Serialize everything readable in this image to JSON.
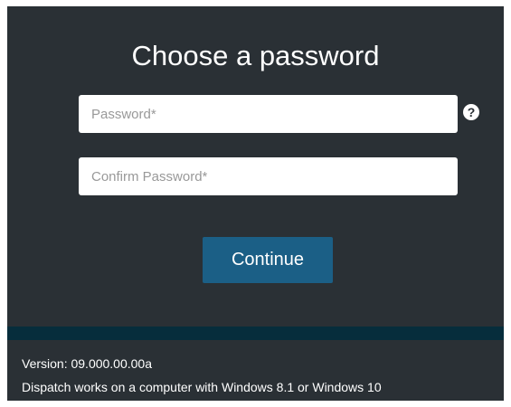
{
  "dialog": {
    "title": "Choose a password",
    "password_placeholder": "Password*",
    "confirm_placeholder": "Confirm Password*",
    "help_glyph": "?",
    "continue_label": "Continue"
  },
  "footer": {
    "version": "Version: 09.000.00.00a",
    "requirements": "Dispatch works on a computer with Windows 8.1 or Windows 10"
  }
}
